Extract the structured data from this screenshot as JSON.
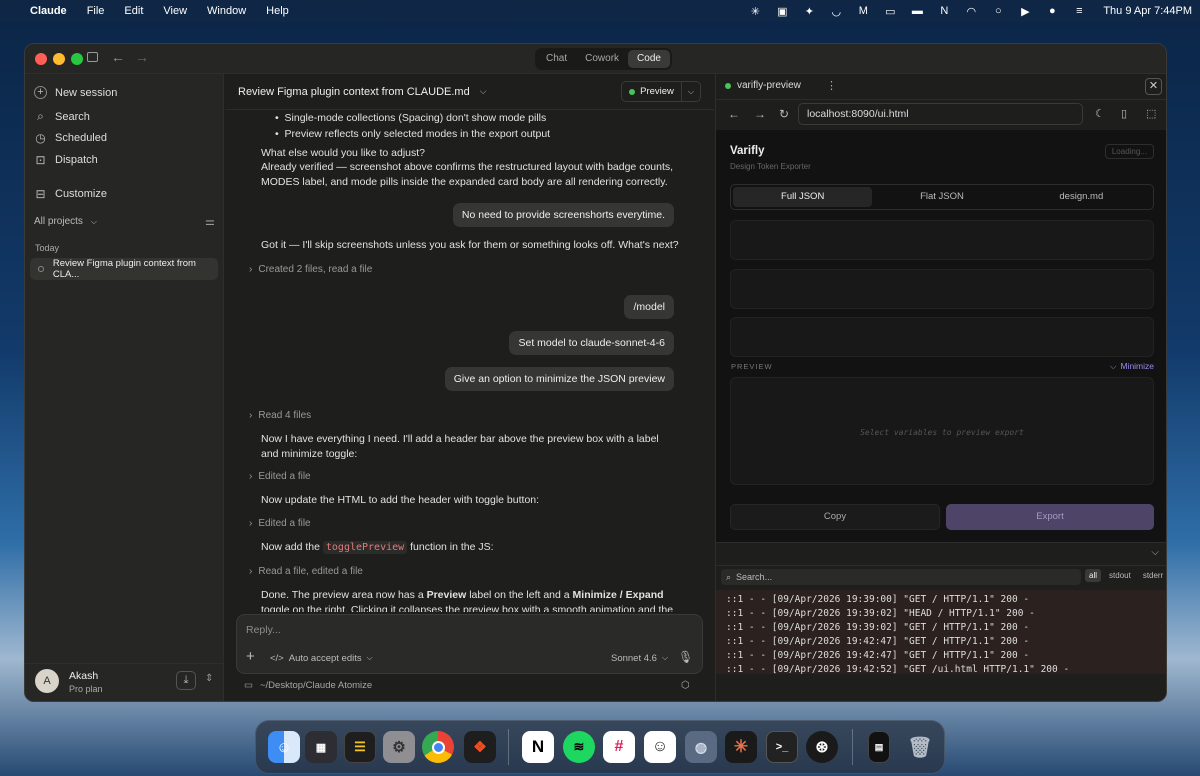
{
  "menubar": {
    "app": "Claude",
    "menus": [
      "File",
      "Edit",
      "View",
      "Window",
      "Help"
    ],
    "clock": "Thu 9 Apr  7:44PM"
  },
  "window": {
    "modes": [
      "Chat",
      "Cowork",
      "Code"
    ],
    "active_mode": "Code"
  },
  "sidebar": {
    "new_session": "New session",
    "search": "Search",
    "scheduled": "Scheduled",
    "dispatch": "Dispatch",
    "customize": "Customize",
    "projects_filter": "All projects",
    "section_today": "Today",
    "session_item": "Review Figma plugin context from CLA...",
    "user": {
      "initial": "A",
      "name": "Akash",
      "plan": "Pro plan"
    }
  },
  "chat": {
    "title": "Review Figma plugin context from CLAUDE.md",
    "preview_button": "Preview",
    "bullet1": "Single-mode collections (Spacing) don't show mode pills",
    "bullet2": "Preview reflects only selected modes in the export output",
    "msg_adjust": "What else would you like to adjust?",
    "msg_verified": "Already verified — screenshot above confirms the restructured layout with badge counts, MODES label, and mode pills inside the expanded card body are all rendering correctly.",
    "user1": "No need to provide screenshorts everytime.",
    "msg_gotit": "Got it — I'll skip screenshots unless you ask for them or something looks off. What's next?",
    "tool1": "Created 2 files, read a file",
    "user2": "/model",
    "user3": "Set model to claude-sonnet-4-6",
    "user4": "Give an option to minimize the JSON preview",
    "tool2": "Read 4 files",
    "msg_now": "Now I have everything I need. I'll add a header bar above the preview box with a label and minimize toggle:",
    "tool3": "Edited a file",
    "msg_update": "Now update the HTML to add the header with toggle button:",
    "tool4": "Edited a file",
    "msg_add_pre": "Now add the",
    "msg_add_code": "togglePreview",
    "msg_add_post": "function in the JS:",
    "tool5": "Read a file, edited a file",
    "msg_done_pre": "Done. The preview area now has a",
    "msg_done_b1": "Preview",
    "msg_done_mid": "label on the left and a",
    "msg_done_b2": "Minimize / Expand",
    "msg_done_post": "toggle on the right. Clicking it collapses the preview box with a smooth animation and the chevron",
    "reply_placeholder": "Reply...",
    "auto_accept": "Auto accept edits",
    "model": "Sonnet 4.6",
    "path": "~/Desktop/Claude Atomize"
  },
  "preview_panel": {
    "tab_title": "varifly-preview",
    "url": "localhost:8090/ui.html",
    "app_title": "Varifly",
    "app_subtitle": "Design Token Exporter",
    "loading": "Loading...",
    "tabs": [
      "Full JSON",
      "Flat JSON",
      "design.md"
    ],
    "preview_label": "PREVIEW",
    "minimize": "Minimize",
    "empty": "Select variables to preview export",
    "copy": "Copy",
    "export": "Export",
    "console_search": "Search...",
    "filters": [
      "all",
      "stdout",
      "stderr"
    ],
    "logs": [
      "::1 - - [09/Apr/2026 19:39:00] \"GET / HTTP/1.1\" 200 -",
      "::1 - - [09/Apr/2026 19:39:02] \"HEAD / HTTP/1.1\" 200 -",
      "::1 - - [09/Apr/2026 19:39:02] \"GET / HTTP/1.1\" 200 -",
      "::1 - - [09/Apr/2026 19:42:47] \"GET / HTTP/1.1\" 200 -",
      "::1 - - [09/Apr/2026 19:42:47] \"GET / HTTP/1.1\" 200 -",
      "::1 - - [09/Apr/2026 19:42:52] \"GET /ui.html HTTP/1.1\" 200 -"
    ]
  }
}
